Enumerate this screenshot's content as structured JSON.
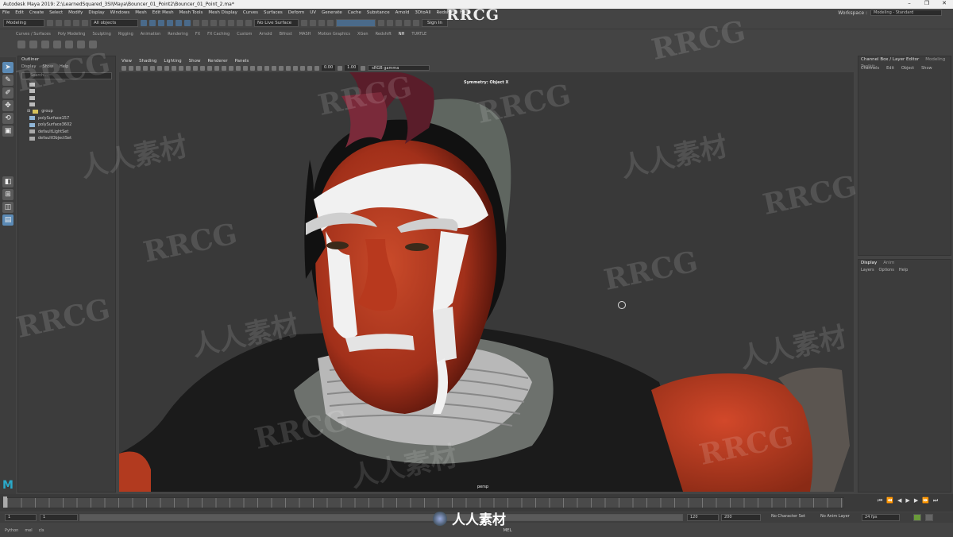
{
  "window": {
    "title": "Autodesk Maya 2019: Z:\\LearnedSquared_3SI\\Maya\\Bouncer_01_Point2\\Bouncer_01_Point_2.ma*"
  },
  "menubar": {
    "items": [
      "File",
      "Edit",
      "Create",
      "Select",
      "Modify",
      "Display",
      "Windows",
      "Mesh",
      "Edit Mesh",
      "Mesh Tools",
      "Mesh Display",
      "Curves",
      "Surfaces",
      "Deform",
      "UV",
      "Generate",
      "Cache",
      "Substance",
      "Arnold",
      "3DtoAll",
      "Redshift",
      "Help"
    ],
    "workspace_label": "Workspace :",
    "workspace_value": "Modeling - Standard"
  },
  "statusline": {
    "menuset": "Modeling",
    "objects_dropdown": "All objects",
    "live_surface": "No Live Surface",
    "sign_in": "Sign In"
  },
  "shelf": {
    "tabs": [
      "Curves / Surfaces",
      "Poly Modeling",
      "Sculpting",
      "Rigging",
      "Animation",
      "Rendering",
      "FX",
      "FX Caching",
      "Custom",
      "Arnold",
      "Bifrost",
      "MASH",
      "Motion Graphics",
      "XGen",
      "Redshift",
      "NH",
      "TURTLE"
    ],
    "active_tab": "NH"
  },
  "outliner": {
    "title": "Outliner",
    "menus": [
      "Display",
      "Show",
      "Help"
    ],
    "search_placeholder": "Search...",
    "items": [
      "",
      "",
      "",
      "",
      "group",
      "polySurface157",
      "polySurface3602",
      "defaultLightSet",
      "defaultObjectSet"
    ]
  },
  "viewport": {
    "menus": [
      "View",
      "Shading",
      "Lighting",
      "Show",
      "Renderer",
      "Panels"
    ],
    "field_a": "0.00",
    "field_b": "1.00",
    "color_space": "sRGB gamma",
    "symmetry_label": "Symmetry: Object X",
    "camera_label": "persp"
  },
  "channel_box": {
    "title": "Channel Box / Layer Editor",
    "tab2": "Modeling Toolkit",
    "menus": [
      "Channels",
      "Edit",
      "Object",
      "Show"
    ]
  },
  "layer_editor": {
    "tabs": [
      "Display",
      "Anim"
    ],
    "menus": [
      "Layers",
      "Options",
      "Help"
    ]
  },
  "range": {
    "start": "1",
    "start2": "1",
    "end": "120",
    "end2": "200",
    "character_set": "No Character Set",
    "anim_layer": "No Anim Layer",
    "fps": "24 fps"
  },
  "cmdline": {
    "items": [
      "Python",
      "mel",
      "cls"
    ],
    "lang": "MEL"
  },
  "watermark": {
    "text": "RRCG",
    "cn": "人人素材"
  }
}
